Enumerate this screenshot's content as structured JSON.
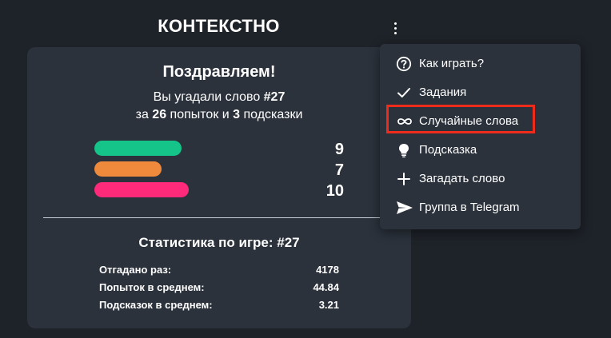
{
  "header": {
    "title": "КОНТЕКСТНО",
    "menu_icon": "vertical-dots-icon"
  },
  "result": {
    "title": "Поздравляем!",
    "line1_prefix": "Вы угадали слово ",
    "line1_game": "#27",
    "line2_pre": "за ",
    "attempts": "26",
    "line2_mid": " попыток и ",
    "hints": "3",
    "line2_post": " подсказки",
    "bars": [
      {
        "color": "#14c488",
        "count": "9"
      },
      {
        "color": "#ef8a3c",
        "count": "7"
      },
      {
        "color": "#ff2a7a",
        "count": "10"
      }
    ]
  },
  "stats": {
    "title": "Статистика по игре: #27",
    "rows": [
      {
        "label": "Отгадано раз:",
        "value": "4178"
      },
      {
        "label": "Попыток в среднем:",
        "value": "44.84"
      },
      {
        "label": "Подсказок в среднем:",
        "value": "3.21"
      }
    ]
  },
  "menu": {
    "items": [
      {
        "label": "Как играть?",
        "icon": "question-circle-icon"
      },
      {
        "label": "Задания",
        "icon": "checkmark-icon"
      },
      {
        "label": "Случайные слова",
        "icon": "infinity-icon"
      },
      {
        "label": "Подсказка",
        "icon": "lightbulb-icon"
      },
      {
        "label": "Загадать слово",
        "icon": "plus-icon"
      },
      {
        "label": "Группа в Telegram",
        "icon": "send-icon"
      }
    ],
    "highlight_color": "#ef2b1c"
  }
}
